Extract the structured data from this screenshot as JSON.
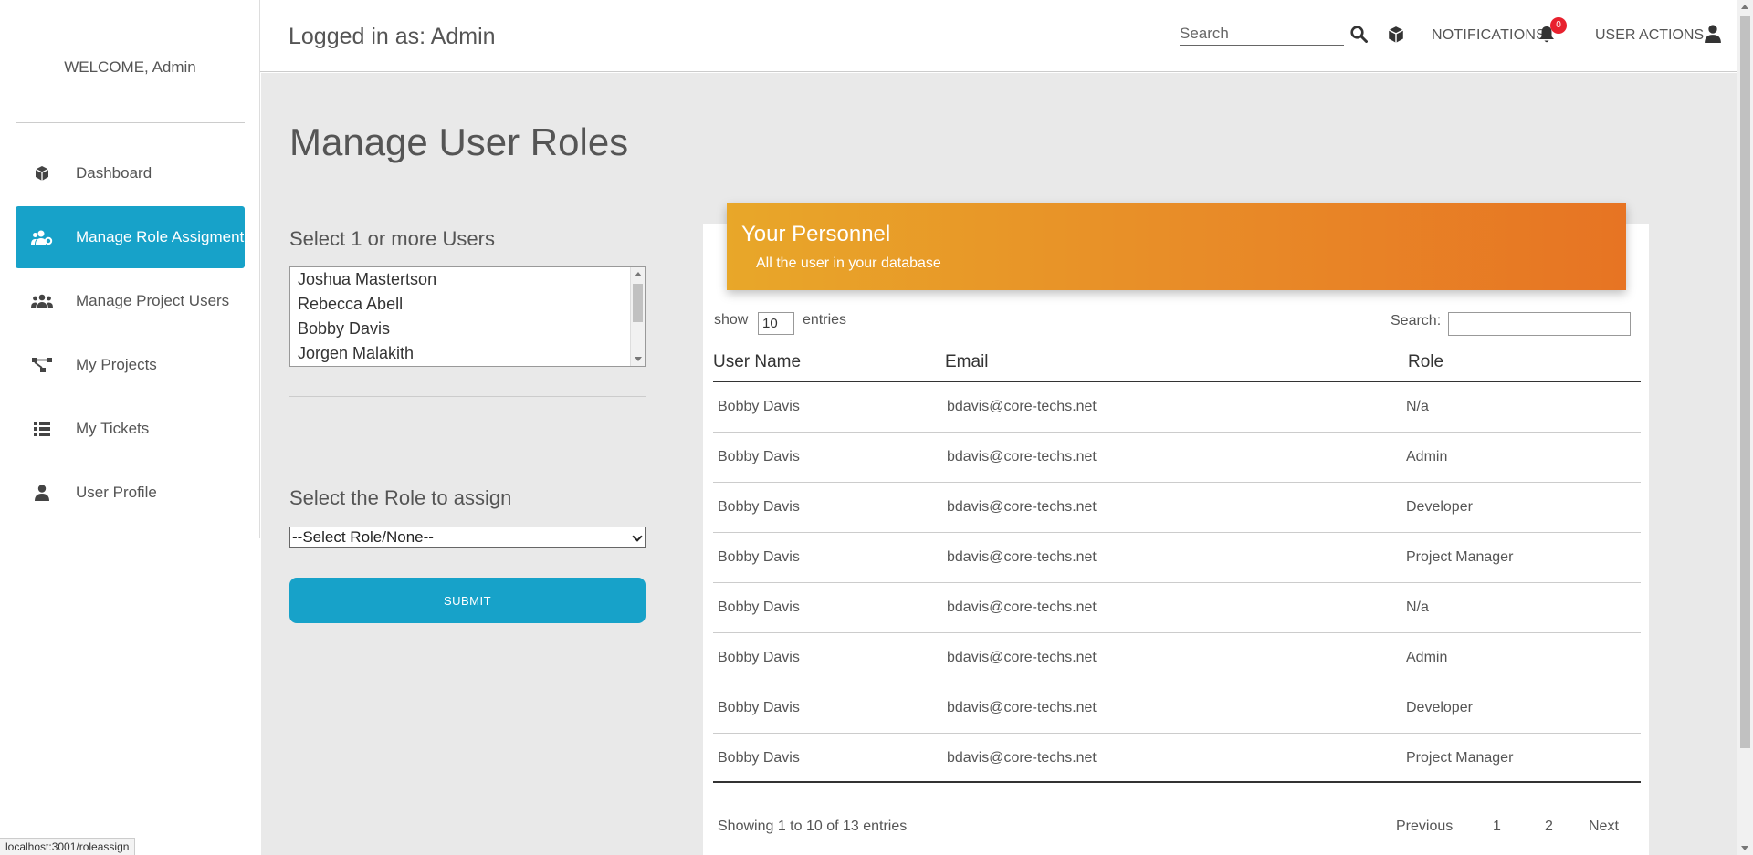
{
  "sidebar": {
    "welcome": "WELCOME, Admin",
    "items": [
      {
        "label": "Dashboard",
        "icon": "cube-icon"
      },
      {
        "label": "Manage Role Assigment",
        "icon": "users-cog-icon",
        "active": true
      },
      {
        "label": "Manage Project Users",
        "icon": "users-icon"
      },
      {
        "label": "My Projects",
        "icon": "project-diagram-icon"
      },
      {
        "label": "My Tickets",
        "icon": "list-icon"
      },
      {
        "label": "User Profile",
        "icon": "user-icon"
      }
    ]
  },
  "topbar": {
    "logged_in": "Logged in as: Admin",
    "search_placeholder": "Search",
    "notifications_label": "NOTIFICATIONS",
    "notifications_count": "0",
    "user_actions_label": "USER ACTIONS"
  },
  "main": {
    "title": "Manage User Roles",
    "select_users_label": "Select 1 or more Users",
    "users": [
      "Joshua Mastertson",
      "Rebecca Abell",
      "Bobby Davis",
      "Jorgen Malakith"
    ],
    "select_role_label": "Select the Role to assign",
    "role_selected": "--Select Role/None--",
    "submit_label": "SUBMIT"
  },
  "personnel": {
    "title": "Your Personnel",
    "subtitle": "All the user in your database",
    "show_label": "show",
    "show_value": "10",
    "entries_label": "entries",
    "search_label": "Search:",
    "columns": [
      "User Name",
      "Email",
      "Role"
    ],
    "rows": [
      [
        "Bobby Davis",
        "bdavis@core-techs.net",
        "N/a"
      ],
      [
        "Bobby Davis",
        "bdavis@core-techs.net",
        "Admin"
      ],
      [
        "Bobby Davis",
        "bdavis@core-techs.net",
        "Developer"
      ],
      [
        "Bobby Davis",
        "bdavis@core-techs.net",
        "Project Manager"
      ],
      [
        "Bobby Davis",
        "bdavis@core-techs.net",
        "N/a"
      ],
      [
        "Bobby Davis",
        "bdavis@core-techs.net",
        "Admin"
      ],
      [
        "Bobby Davis",
        "bdavis@core-techs.net",
        "Developer"
      ],
      [
        "Bobby Davis",
        "bdavis@core-techs.net",
        "Project Manager"
      ]
    ],
    "showing": "Showing 1 to 10 of 13 entries",
    "pagination": {
      "previous": "Previous",
      "page1": "1",
      "page2": "2",
      "next": "Next"
    }
  },
  "statusbar": {
    "url": "localhost:3001/roleassign"
  },
  "colors": {
    "accent": "#17a2c9",
    "header_gradient_start": "#e8a729",
    "header_gradient_end": "#e77423",
    "badge": "#e8212e"
  }
}
